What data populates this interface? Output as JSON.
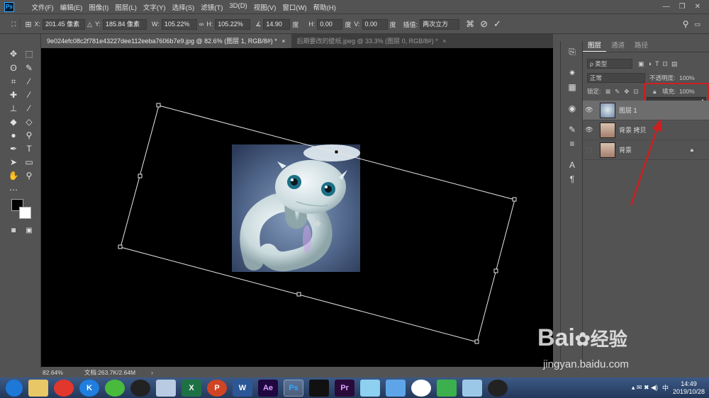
{
  "app": {
    "logo": "Ps"
  },
  "menu": [
    "文件(F)",
    "编辑(E)",
    "图像(I)",
    "图层(L)",
    "文字(Y)",
    "选择(S)",
    "滤镜(T)",
    "3D(D)",
    "视图(V)",
    "窗口(W)",
    "帮助(H)"
  ],
  "window_controls": {
    "minimize": "—",
    "restore": "❐",
    "close": "✕"
  },
  "options": {
    "x_label": "X:",
    "x_value": "201.45 像素",
    "y_label": "Y:",
    "y_value": "185.84 像素",
    "w_label": "W:",
    "w_value": "105.22%",
    "h_label": "H:",
    "h_value": "105.22%",
    "angle_value": "14.90",
    "angle_unit": "度",
    "hskew_label": "H:",
    "hskew_value": "0.00",
    "hskew_unit": "度",
    "vskew_label": "V:",
    "vskew_value": "0.00",
    "vskew_unit": "度",
    "interp_label": "插值:",
    "interp_value": "两次立方"
  },
  "tabs": [
    {
      "label": "9e024efc08c2f781e43227dee112eeba7606b7e9.jpg @ 82.6% (图层 1, RGB/8#) *",
      "close": "×"
    },
    {
      "label": "后期要改的壁纸.jpeg @ 33.3% (图层 0, RGB/8#) *",
      "close": "×"
    }
  ],
  "status": {
    "zoom": "82.64%",
    "doc": "文档:263.7K/2.64M",
    "arrow": "›"
  },
  "panel": {
    "tabs": [
      "图层",
      "通道",
      "路径"
    ],
    "kind_label": "ρ 类型",
    "blend_mode": "正常",
    "opacity_label": "不透明度:",
    "opacity_value": "100%",
    "lock_label": "锁定:",
    "fill_label": "填充:",
    "fill_value": "100%",
    "fill_slider": 1.0,
    "layers": [
      {
        "name": "图层 1",
        "visible": true,
        "selected": true
      },
      {
        "name": "背景 拷贝",
        "visible": true,
        "selected": false
      },
      {
        "name": "背景",
        "visible": false,
        "selected": false,
        "locked": true
      }
    ]
  },
  "taskbar": {
    "apps": [
      "",
      "",
      "",
      "K",
      "",
      "",
      "",
      "X",
      "P",
      "W",
      "Ae",
      "Ps",
      "",
      "Pr",
      "",
      "",
      "",
      "",
      "",
      ""
    ],
    "tray_ime": "中",
    "time": "14:49",
    "date": "2019/10/28"
  },
  "watermark": {
    "brand": "Bai",
    "brand2": "经验",
    "url": "jingyan.baidu.com"
  },
  "colors": {
    "accent_red": "#cc1f1f",
    "ps_blue": "#31a8ff",
    "taskbar": "#2a4470"
  }
}
